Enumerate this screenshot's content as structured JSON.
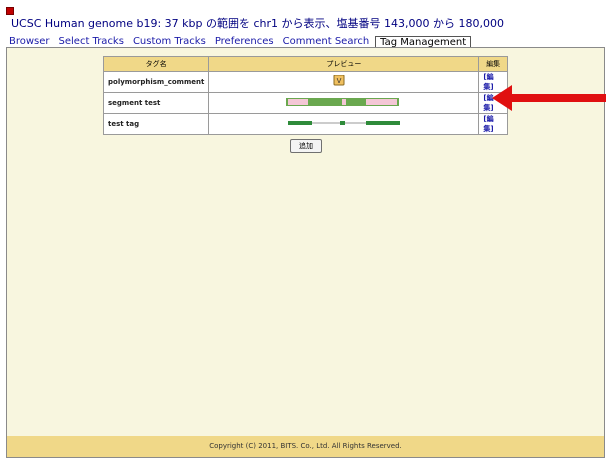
{
  "header": {
    "title": "UCSC Human genome b19: 37 kbp の範囲を chr1 から表示、塩基番号 143,000 から 180,000"
  },
  "tabs": [
    {
      "label": "Browser"
    },
    {
      "label": "Select Tracks"
    },
    {
      "label": "Custom Tracks"
    },
    {
      "label": "Preferences"
    },
    {
      "label": "Comment Search"
    },
    {
      "label": "Tag Management",
      "active": true
    }
  ],
  "table": {
    "headers": {
      "name": "タグ名",
      "preview": "プレビュー",
      "edit": "編集"
    },
    "rows": [
      {
        "name": "polymorphism_comment",
        "preview_type": "marker",
        "marker_glyph": "V",
        "edit": "[編集]"
      },
      {
        "name": "segment test",
        "preview_type": "segment-bar",
        "edit": "[編集]"
      },
      {
        "name": "test tag",
        "preview_type": "line-bar",
        "edit": "[編集]"
      }
    ]
  },
  "add_button": {
    "label": "追加"
  },
  "footer": {
    "copyright": "Copyright (C) 2011, BITS. Co., Ltd. All Rights Reserved."
  },
  "colors": {
    "accent_red": "#e01010",
    "segment_green": "#6aa84f",
    "segment_pink": "#f4c7d6",
    "line_green": "#2e8b3a",
    "marker_fill": "#f0c060"
  }
}
